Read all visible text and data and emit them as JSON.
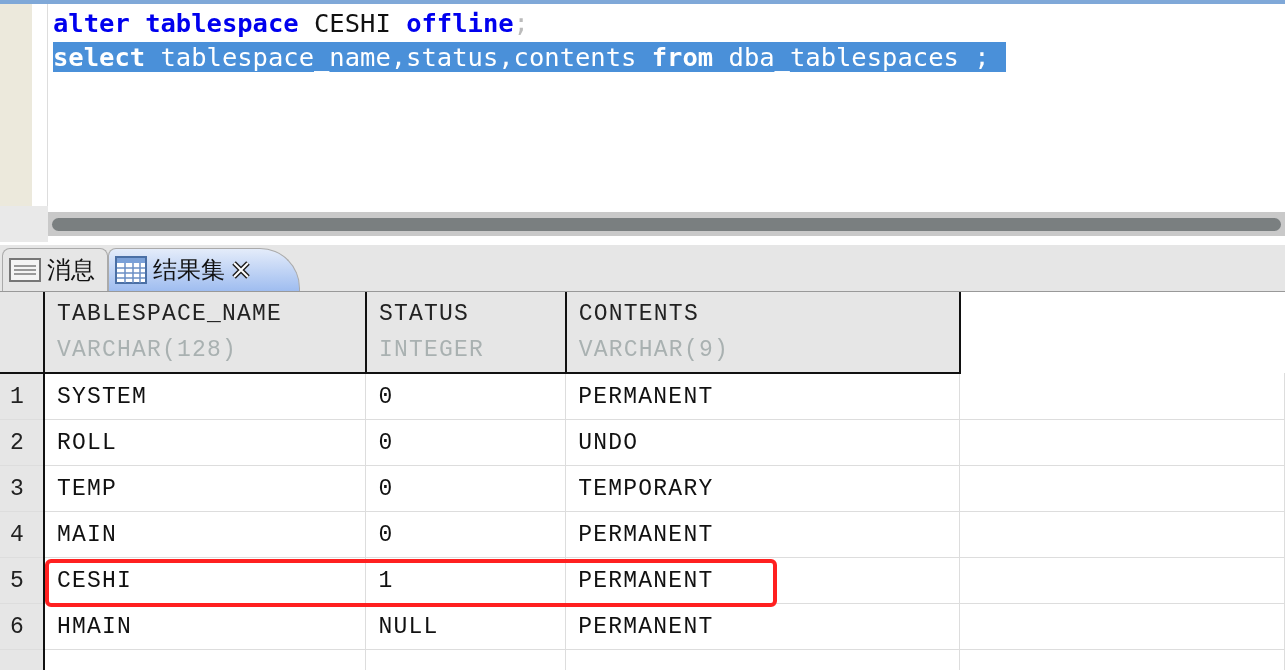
{
  "editor": {
    "lines": [
      {
        "selected": false,
        "tokens": [
          {
            "kind": "keyword",
            "text": "alter"
          },
          {
            "kind": "keyword",
            "text": "tablespace"
          },
          {
            "kind": "ident",
            "text": "CESHI"
          },
          {
            "kind": "keyword",
            "text": "offline"
          },
          {
            "kind": "punct",
            "text": ";",
            "attached": true
          }
        ]
      },
      {
        "selected": true,
        "tokens": [
          {
            "kind": "keyword",
            "text": "select"
          },
          {
            "kind": "ident",
            "text": "tablespace_name,status,contents"
          },
          {
            "kind": "keyword",
            "text": "from"
          },
          {
            "kind": "ident",
            "text": "dba_tablespaces"
          },
          {
            "kind": "punct",
            "text": ";",
            "attached": false
          }
        ]
      }
    ]
  },
  "tabs": [
    {
      "label": "消息",
      "kind": "messages",
      "selected": false,
      "closable": false
    },
    {
      "label": "结果集",
      "kind": "results",
      "selected": true,
      "closable": true
    }
  ],
  "table": {
    "columns": [
      {
        "name": "TABLESPACE_NAME",
        "type": "VARCHAR(128)"
      },
      {
        "name": "STATUS",
        "type": "INTEGER"
      },
      {
        "name": "CONTENTS",
        "type": "VARCHAR(9)"
      }
    ],
    "rows": [
      {
        "number": "1",
        "cells": [
          "SYSTEM",
          "0",
          "PERMANENT"
        ],
        "highlighted": false
      },
      {
        "number": "2",
        "cells": [
          "ROLL",
          "0",
          "UNDO"
        ],
        "highlighted": false
      },
      {
        "number": "3",
        "cells": [
          "TEMP",
          "0",
          "TEMPORARY"
        ],
        "highlighted": false
      },
      {
        "number": "4",
        "cells": [
          "MAIN",
          "0",
          "PERMANENT"
        ],
        "highlighted": false
      },
      {
        "number": "5",
        "cells": [
          "CESHI",
          "1",
          "PERMANENT"
        ],
        "highlighted": true
      },
      {
        "number": "6",
        "cells": [
          "HMAIN",
          "NULL",
          "PERMANENT"
        ],
        "highlighted": false
      }
    ]
  }
}
